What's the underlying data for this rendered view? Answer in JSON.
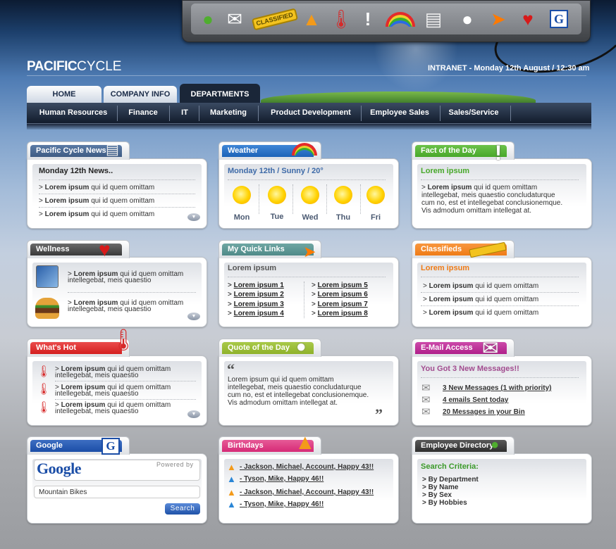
{
  "header": {
    "logo_bold": "PACIFIC",
    "logo_light": "CYCLE",
    "intranet": "INTRANET - Monday 12th August / 12:30 am"
  },
  "toolbar": {
    "icons": [
      "people-icon",
      "mail-icon",
      "classified-icon",
      "party-hat-icon",
      "thermometer-icon",
      "exclamation-icon",
      "rainbow-icon",
      "newspaper-icon",
      "speech-bubble-icon",
      "cursor-icon",
      "heart-icon",
      "google-icon"
    ]
  },
  "tabs": [
    {
      "label": "HOME"
    },
    {
      "label": "COMPANY INFO"
    },
    {
      "label": "DEPARTMENTS"
    }
  ],
  "subnav": [
    {
      "label": "Human Resources"
    },
    {
      "label": "Finance"
    },
    {
      "label": "IT"
    },
    {
      "label": "Marketing"
    },
    {
      "label": "Product Development"
    },
    {
      "label": "Employee Sales"
    },
    {
      "label": "Sales/Service"
    }
  ],
  "colors": {
    "news": "#3f5c84",
    "weather": "#1c63b8",
    "fact": "#48a82a",
    "wellness": "#4a4a4a",
    "quicklinks": "#4f8a88",
    "classifieds": "#ef7b16",
    "hot": "#d41f1f",
    "quote": "#8fb22a",
    "email": "#b01f8a",
    "google": "#1b4ea7",
    "birthdays": "#d62a76",
    "directory": "#3a3a3a"
  },
  "news": {
    "title": "Pacific Cycle News",
    "heading": "Monday 12th News..",
    "items": [
      {
        "bold": "Lorem ipsum",
        "text": "qui id quem omittam"
      },
      {
        "bold": "Lorem ipsum",
        "text": "qui id quem omittam"
      },
      {
        "bold": "Lorem ipsum",
        "text": "qui id quem omittam"
      }
    ]
  },
  "weather": {
    "title": "Weather",
    "heading": "Monday 12th / Sunny / 20°",
    "days": [
      "Mon",
      "Tue",
      "Wed",
      "Thu",
      "Fri"
    ]
  },
  "fact": {
    "title": "Fact of the Day",
    "heading": "Lorem ipsum",
    "bold": "Lorem ipsum",
    "line1": "qui id quem omittam",
    "line2": "intellegebat, meis quaestio concludaturque",
    "line3": "cum no, est et intellegebat conclusionemque.",
    "line4": "Vis admodum omittam intellegat at."
  },
  "wellness": {
    "title": "Wellness",
    "items": [
      {
        "bold": "Lorem ipsum",
        "l1": "qui id quem omittam",
        "l2": "intellegebat, meis quaestio"
      },
      {
        "bold": "Lorem ipsum",
        "l1": "qui id quem omittam",
        "l2": "intellegebat, meis quaestio"
      }
    ]
  },
  "quicklinks": {
    "title": "My Quick Links",
    "heading": "Lorem ipsum",
    "col1": [
      "Lorem ipsum 1",
      "Lorem ipsum 2",
      "Lorem ipsum 3",
      "Lorem ipsum 4"
    ],
    "col2": [
      "Lorem ipsum 5",
      "Lorem ipsum 6",
      "Lorem ipsum 7",
      "Lorem ipsum 8"
    ]
  },
  "classifieds": {
    "title": "Classifieds",
    "heading": "Lorem ipsum",
    "items": [
      {
        "bold": "Lorem ipsum",
        "text": "qui id quem omittam"
      },
      {
        "bold": "Lorem ipsum",
        "text": "qui id quem omittam"
      },
      {
        "bold": "Lorem ipsum",
        "text": "qui id quem omittam"
      }
    ]
  },
  "hot": {
    "title": "What's Hot",
    "items": [
      {
        "bold": "Lorem ipsum",
        "l1": "qui id quem omittam",
        "l2": "intellegebat, meis quaestio"
      },
      {
        "bold": "Lorem ipsum",
        "l1": "qui id quem omittam",
        "l2": "intellegebat, meis quaestio"
      },
      {
        "bold": "Lorem ipsum",
        "l1": "qui id quem omittam",
        "l2": "intellegebat, meis quaestio"
      }
    ]
  },
  "quote": {
    "title": "Quote of the Day",
    "l1": "Lorem ipsum qui id quem omittam",
    "l2": "intellegebat, meis quaestio concludaturque",
    "l3": "cum no, est et intellegebat conclusionemque.",
    "l4": "Vis admodum omittam intellegat at."
  },
  "email": {
    "title": "E-Mail Access",
    "heading": "You Got 3 New Messages!!",
    "items": [
      "3 New Messages (1 with priority)",
      "4 emails Sent today",
      "20 Messages in your Bin"
    ]
  },
  "google": {
    "title": "Google",
    "logo": "Google",
    "powered": "Powered by",
    "search_value": "Mountain Bikes",
    "button": "Search"
  },
  "birthdays": {
    "title": "Birthdays",
    "items": [
      "- Jackson, Michael, Account, Happy 43!!",
      "- Tyson, Mike, Happy 46!!",
      "- Jackson, Michael, Account, Happy 43!!",
      "- Tyson, Mike, Happy 46!!"
    ]
  },
  "directory": {
    "title": "Employee Directory",
    "heading": "Search Criteria:",
    "items": [
      "By Department",
      "By Name",
      "By Sex",
      "By Hobbies"
    ]
  }
}
